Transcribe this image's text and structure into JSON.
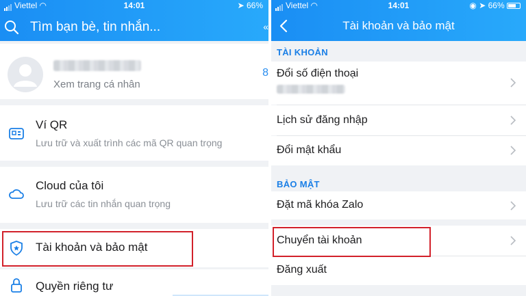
{
  "left": {
    "status": {
      "carrier": "Viettel",
      "time": "14:01",
      "battery": "66%"
    },
    "search": {
      "placeholder": "Tìm bạn bè, tin nhắn..."
    },
    "profile": {
      "subtitle": "Xem trang cá nhân"
    },
    "items": [
      {
        "title": "Ví QR",
        "subtitle": "Lưu trữ và xuất trình các mã QR quan trọng",
        "icon": "qr-wallet-icon"
      },
      {
        "title": "Cloud của tôi",
        "subtitle": "Lưu trữ các tin nhắn quan trọng",
        "icon": "cloud-icon"
      },
      {
        "title": "Tài khoản và bảo mật",
        "icon": "shield-icon"
      },
      {
        "title": "Quyền riêng tư",
        "icon": "lock-icon"
      }
    ]
  },
  "right": {
    "status": {
      "carrier": "Viettel",
      "time": "14:01",
      "battery": "66%"
    },
    "title": "Tài khoản và bảo mật",
    "sections": {
      "account": "TÀI KHOẢN",
      "security": "BẢO MẬT"
    },
    "rows": {
      "change_phone": "Đổi số điện thoại",
      "login_history": "Lịch sử đăng nhập",
      "change_password": "Đổi mật khẩu",
      "zalo_lock": "Đặt mã khóa Zalo",
      "switch_account": "Chuyển tài khoản",
      "logout": "Đăng xuất"
    }
  },
  "colors": {
    "header": "#1a8ef4",
    "accent": "#1a7fe6",
    "highlight": "#d2202a"
  }
}
